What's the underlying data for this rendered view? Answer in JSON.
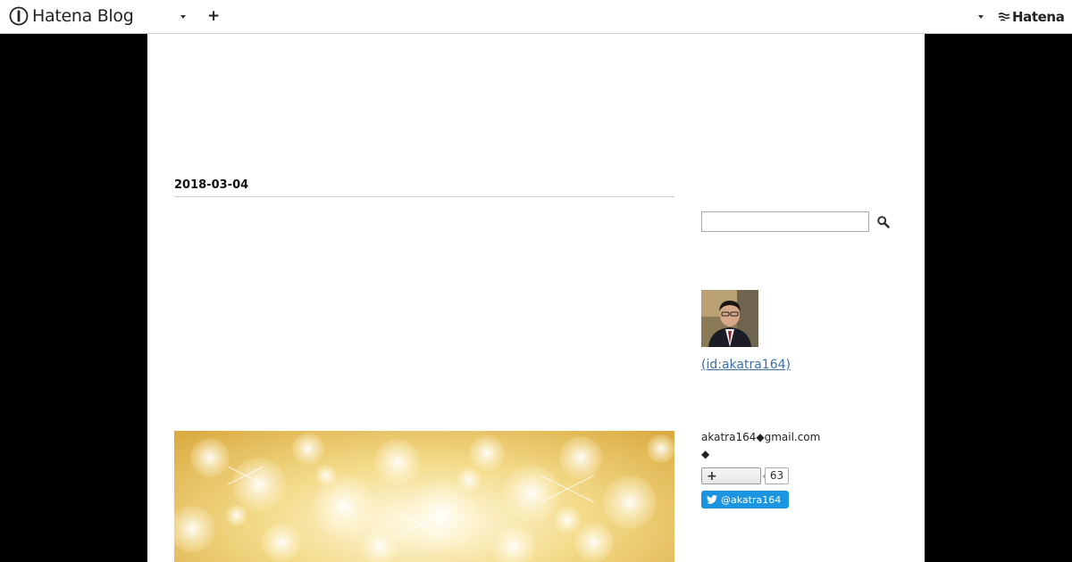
{
  "header": {
    "brand": "Hatena Blog",
    "add_label": "+",
    "hatena_label": "Hatena"
  },
  "main": {
    "date": "2018-03-04"
  },
  "sidebar": {
    "search": {
      "value": "",
      "placeholder": ""
    },
    "profile": {
      "link_text": " (id:akatra164)"
    },
    "contact": {
      "email": "akatra164◆gmail.com",
      "note": "◆"
    },
    "reader": {
      "plus_label": "+",
      "count": "63"
    },
    "twitter": {
      "label": "@akatra164"
    }
  },
  "icons": {
    "brand": "hatena-blog-logo-icon",
    "dropdown": "caret-down-icon",
    "search": "magnifier-icon",
    "twitter": "twitter-bird-icon"
  },
  "colors": {
    "page_bg": "#000000",
    "content_bg": "#ffffff",
    "link": "#3d6fa6",
    "twitter": "#1b95e0"
  }
}
